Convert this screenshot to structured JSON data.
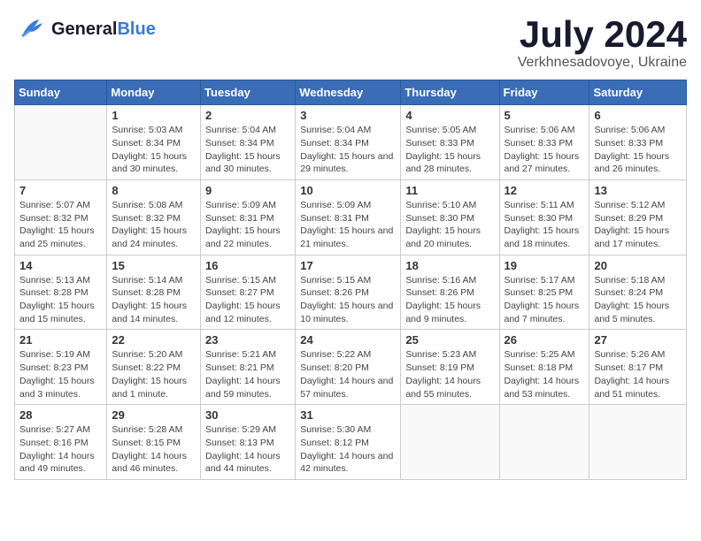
{
  "header": {
    "logo_general": "General",
    "logo_blue": "Blue",
    "month_title": "July 2024",
    "subtitle": "Verkhnesadovoye, Ukraine"
  },
  "days_of_week": [
    "Sunday",
    "Monday",
    "Tuesday",
    "Wednesday",
    "Thursday",
    "Friday",
    "Saturday"
  ],
  "weeks": [
    [
      {
        "day": "",
        "sunrise": "",
        "sunset": "",
        "daylight": ""
      },
      {
        "day": "1",
        "sunrise": "Sunrise: 5:03 AM",
        "sunset": "Sunset: 8:34 PM",
        "daylight": "Daylight: 15 hours and 30 minutes."
      },
      {
        "day": "2",
        "sunrise": "Sunrise: 5:04 AM",
        "sunset": "Sunset: 8:34 PM",
        "daylight": "Daylight: 15 hours and 30 minutes."
      },
      {
        "day": "3",
        "sunrise": "Sunrise: 5:04 AM",
        "sunset": "Sunset: 8:34 PM",
        "daylight": "Daylight: 15 hours and 29 minutes."
      },
      {
        "day": "4",
        "sunrise": "Sunrise: 5:05 AM",
        "sunset": "Sunset: 8:33 PM",
        "daylight": "Daylight: 15 hours and 28 minutes."
      },
      {
        "day": "5",
        "sunrise": "Sunrise: 5:06 AM",
        "sunset": "Sunset: 8:33 PM",
        "daylight": "Daylight: 15 hours and 27 minutes."
      },
      {
        "day": "6",
        "sunrise": "Sunrise: 5:06 AM",
        "sunset": "Sunset: 8:33 PM",
        "daylight": "Daylight: 15 hours and 26 minutes."
      }
    ],
    [
      {
        "day": "7",
        "sunrise": "Sunrise: 5:07 AM",
        "sunset": "Sunset: 8:32 PM",
        "daylight": "Daylight: 15 hours and 25 minutes."
      },
      {
        "day": "8",
        "sunrise": "Sunrise: 5:08 AM",
        "sunset": "Sunset: 8:32 PM",
        "daylight": "Daylight: 15 hours and 24 minutes."
      },
      {
        "day": "9",
        "sunrise": "Sunrise: 5:09 AM",
        "sunset": "Sunset: 8:31 PM",
        "daylight": "Daylight: 15 hours and 22 minutes."
      },
      {
        "day": "10",
        "sunrise": "Sunrise: 5:09 AM",
        "sunset": "Sunset: 8:31 PM",
        "daylight": "Daylight: 15 hours and 21 minutes."
      },
      {
        "day": "11",
        "sunrise": "Sunrise: 5:10 AM",
        "sunset": "Sunset: 8:30 PM",
        "daylight": "Daylight: 15 hours and 20 minutes."
      },
      {
        "day": "12",
        "sunrise": "Sunrise: 5:11 AM",
        "sunset": "Sunset: 8:30 PM",
        "daylight": "Daylight: 15 hours and 18 minutes."
      },
      {
        "day": "13",
        "sunrise": "Sunrise: 5:12 AM",
        "sunset": "Sunset: 8:29 PM",
        "daylight": "Daylight: 15 hours and 17 minutes."
      }
    ],
    [
      {
        "day": "14",
        "sunrise": "Sunrise: 5:13 AM",
        "sunset": "Sunset: 8:28 PM",
        "daylight": "Daylight: 15 hours and 15 minutes."
      },
      {
        "day": "15",
        "sunrise": "Sunrise: 5:14 AM",
        "sunset": "Sunset: 8:28 PM",
        "daylight": "Daylight: 15 hours and 14 minutes."
      },
      {
        "day": "16",
        "sunrise": "Sunrise: 5:15 AM",
        "sunset": "Sunset: 8:27 PM",
        "daylight": "Daylight: 15 hours and 12 minutes."
      },
      {
        "day": "17",
        "sunrise": "Sunrise: 5:15 AM",
        "sunset": "Sunset: 8:26 PM",
        "daylight": "Daylight: 15 hours and 10 minutes."
      },
      {
        "day": "18",
        "sunrise": "Sunrise: 5:16 AM",
        "sunset": "Sunset: 8:26 PM",
        "daylight": "Daylight: 15 hours and 9 minutes."
      },
      {
        "day": "19",
        "sunrise": "Sunrise: 5:17 AM",
        "sunset": "Sunset: 8:25 PM",
        "daylight": "Daylight: 15 hours and 7 minutes."
      },
      {
        "day": "20",
        "sunrise": "Sunrise: 5:18 AM",
        "sunset": "Sunset: 8:24 PM",
        "daylight": "Daylight: 15 hours and 5 minutes."
      }
    ],
    [
      {
        "day": "21",
        "sunrise": "Sunrise: 5:19 AM",
        "sunset": "Sunset: 8:23 PM",
        "daylight": "Daylight: 15 hours and 3 minutes."
      },
      {
        "day": "22",
        "sunrise": "Sunrise: 5:20 AM",
        "sunset": "Sunset: 8:22 PM",
        "daylight": "Daylight: 15 hours and 1 minute."
      },
      {
        "day": "23",
        "sunrise": "Sunrise: 5:21 AM",
        "sunset": "Sunset: 8:21 PM",
        "daylight": "Daylight: 14 hours and 59 minutes."
      },
      {
        "day": "24",
        "sunrise": "Sunrise: 5:22 AM",
        "sunset": "Sunset: 8:20 PM",
        "daylight": "Daylight: 14 hours and 57 minutes."
      },
      {
        "day": "25",
        "sunrise": "Sunrise: 5:23 AM",
        "sunset": "Sunset: 8:19 PM",
        "daylight": "Daylight: 14 hours and 55 minutes."
      },
      {
        "day": "26",
        "sunrise": "Sunrise: 5:25 AM",
        "sunset": "Sunset: 8:18 PM",
        "daylight": "Daylight: 14 hours and 53 minutes."
      },
      {
        "day": "27",
        "sunrise": "Sunrise: 5:26 AM",
        "sunset": "Sunset: 8:17 PM",
        "daylight": "Daylight: 14 hours and 51 minutes."
      }
    ],
    [
      {
        "day": "28",
        "sunrise": "Sunrise: 5:27 AM",
        "sunset": "Sunset: 8:16 PM",
        "daylight": "Daylight: 14 hours and 49 minutes."
      },
      {
        "day": "29",
        "sunrise": "Sunrise: 5:28 AM",
        "sunset": "Sunset: 8:15 PM",
        "daylight": "Daylight: 14 hours and 46 minutes."
      },
      {
        "day": "30",
        "sunrise": "Sunrise: 5:29 AM",
        "sunset": "Sunset: 8:13 PM",
        "daylight": "Daylight: 14 hours and 44 minutes."
      },
      {
        "day": "31",
        "sunrise": "Sunrise: 5:30 AM",
        "sunset": "Sunset: 8:12 PM",
        "daylight": "Daylight: 14 hours and 42 minutes."
      },
      {
        "day": "",
        "sunrise": "",
        "sunset": "",
        "daylight": ""
      },
      {
        "day": "",
        "sunrise": "",
        "sunset": "",
        "daylight": ""
      },
      {
        "day": "",
        "sunrise": "",
        "sunset": "",
        "daylight": ""
      }
    ]
  ]
}
